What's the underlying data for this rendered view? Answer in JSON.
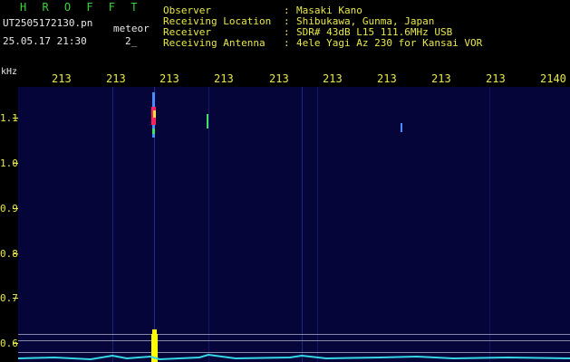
{
  "header": {
    "app_name": "H R O F F T",
    "filename": "UT2505172130.pn",
    "tag": "meteor",
    "timestamp": "25.05.17 21:30",
    "page_indicator": "2_",
    "fields": [
      {
        "label": "Observer",
        "sep": ":",
        "value": "Masaki Kano"
      },
      {
        "label": "Receiving Location",
        "sep": ":",
        "value": "Shibukawa, Gunma, Japan"
      },
      {
        "label": "Receiver",
        "sep": ":",
        "value": "SDR# 43dB L15 111.6MHz USB"
      },
      {
        "label": "Receiving Antenna",
        "sep": ":",
        "value": "4ele Yagi Az 230 for Kansai VOR"
      }
    ]
  },
  "axis": {
    "y_unit": "kHz",
    "x_ticks": [
      "213",
      "213",
      "213",
      "213",
      "213",
      "213",
      "213",
      "213",
      "213",
      "2140"
    ],
    "y_ticks": [
      "1.1",
      "1.0",
      "0.9",
      "0.8",
      "0.7",
      "0.6"
    ]
  },
  "colors": {
    "background": "#000000",
    "plot_bg": "#05053a",
    "label_yellow": "#e8e84a",
    "title_green": "#37d437",
    "signal_yellow": "#ffff00",
    "trace_cyan": "#35d6e6",
    "echo_red": "#ff2060"
  }
}
